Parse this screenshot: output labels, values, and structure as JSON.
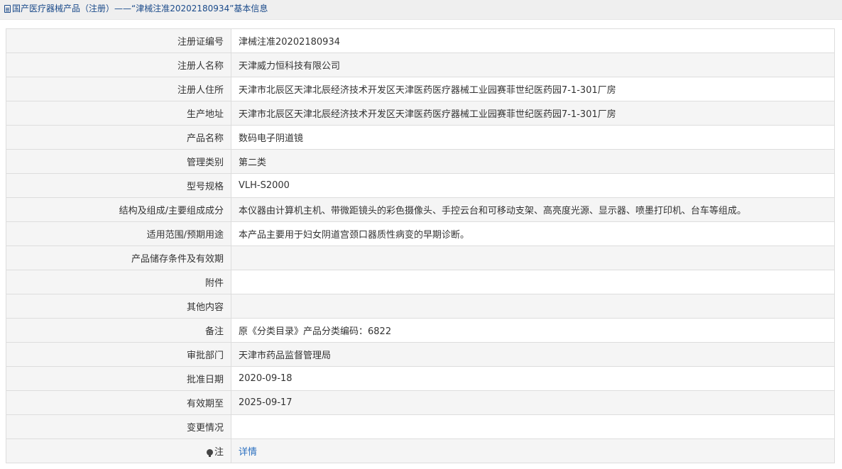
{
  "breadcrumb": {
    "icon": "document-icon",
    "text": "国产医疗器械产品（注册）——“津械注准20202180934”基本信息"
  },
  "rows": [
    {
      "label": "注册证编号",
      "value": "津械注准20202180934"
    },
    {
      "label": "注册人名称",
      "value": "天津威力恒科技有限公司"
    },
    {
      "label": "注册人住所",
      "value": "天津市北辰区天津北辰经济技术开发区天津医药医疗器械工业园赛菲世纪医药园7-1-301厂房"
    },
    {
      "label": "生产地址",
      "value": "天津市北辰区天津北辰经济技术开发区天津医药医疗器械工业园赛菲世纪医药园7-1-301厂房"
    },
    {
      "label": "产品名称",
      "value": "数码电子阴道镜"
    },
    {
      "label": "管理类别",
      "value": "第二类"
    },
    {
      "label": "型号规格",
      "value": "VLH-S2000"
    },
    {
      "label": "结构及组成/主要组成成分",
      "value": "本仪器由计算机主机、带微距镜头的彩色摄像头、手控云台和可移动支架、高亮度光源、显示器、喷墨打印机、台车等组成。"
    },
    {
      "label": "适用范围/预期用途",
      "value": "本产品主要用于妇女阴道宫颈口器质性病变的早期诊断。"
    },
    {
      "label": "产品储存条件及有效期",
      "value": ""
    },
    {
      "label": "附件",
      "value": ""
    },
    {
      "label": "其他内容",
      "value": ""
    },
    {
      "label": "备注",
      "value": "原《分类目录》产品分类编码：6822"
    },
    {
      "label": "审批部门",
      "value": "天津市药品监督管理局"
    },
    {
      "label": "批准日期",
      "value": "2020-09-18"
    },
    {
      "label": "有效期至",
      "value": "2025-09-17"
    },
    {
      "label": "变更情况",
      "value": ""
    }
  ],
  "note": {
    "icon": "lightbulb-icon",
    "label": "注",
    "link_text": "详情"
  },
  "colors": {
    "label_bg": "#f5f5f5",
    "border": "#dddddd",
    "link": "#2a6fc0",
    "breadcrumb_text": "#1a4a8a"
  }
}
